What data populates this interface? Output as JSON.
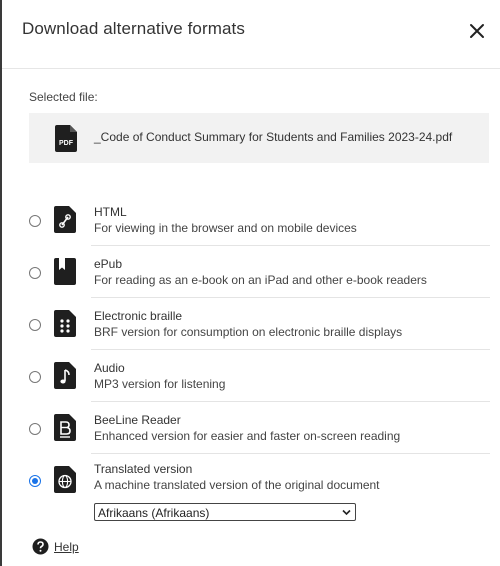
{
  "dialog": {
    "title": "Download alternative formats",
    "close_icon": "close-icon"
  },
  "selected_file": {
    "label": "Selected file:",
    "icon": "pdf-file-icon",
    "icon_text": "PDF",
    "name": "_Code of Conduct Summary for Students and Families 2023-24.pdf"
  },
  "options": [
    {
      "title": "HTML",
      "description": "For viewing in the browser and on mobile devices",
      "icon": "html-link-icon",
      "selected": false
    },
    {
      "title": "ePub",
      "description": "For reading as an e-book on an iPad and other e-book readers",
      "icon": "epub-bookmark-icon",
      "selected": false
    },
    {
      "title": "Electronic braille",
      "description": "BRF version for consumption on electronic braille displays",
      "icon": "braille-icon",
      "selected": false
    },
    {
      "title": "Audio",
      "description": "MP3 version for listening",
      "icon": "audio-note-icon",
      "selected": false
    },
    {
      "title": "BeeLine Reader",
      "description": "Enhanced version for easier and faster on-screen reading",
      "icon": "beeline-icon",
      "selected": false
    },
    {
      "title": "Translated version",
      "description": "A machine translated version of the original document",
      "icon": "globe-icon",
      "selected": true
    }
  ],
  "language_select": {
    "selected": "Afrikaans (Afrikaans)"
  },
  "help": {
    "label": "Help",
    "icon": "question-circle-icon"
  },
  "colors": {
    "accent": "#1a73e8",
    "file_box_bg": "#f2f2f2",
    "icon_fill": "#1f1f1f"
  }
}
